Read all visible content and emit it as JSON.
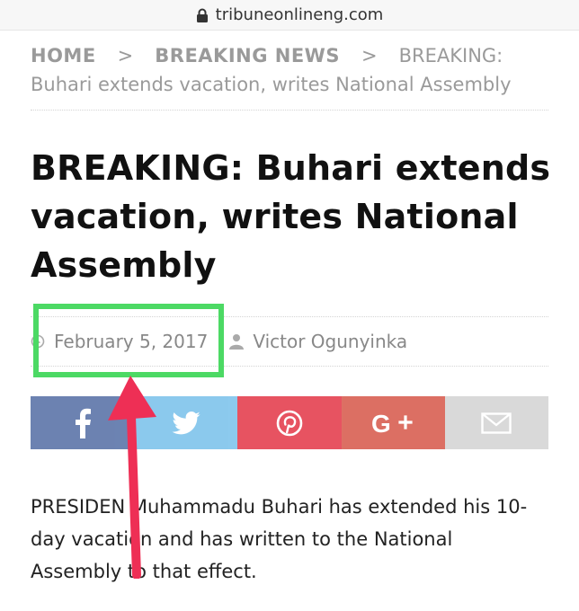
{
  "browser": {
    "url": "tribuneonlineng.com"
  },
  "breadcrumb": {
    "home": "HOME",
    "separator": ">",
    "section": "BREAKING NEWS",
    "current": "BREAKING: Buhari extends vacation, writes National Assembly"
  },
  "article": {
    "title": "BREAKING: Buhari extends vacation, writes National Assembly",
    "date": "February 5, 2017",
    "author": "Victor Ogunyinka",
    "paragraph_before_arrow": "PRESIDEN",
    "paragraph_after_arrow": " Muhammadu Buhari has extended his 10-day vac",
    "paragraph_rest": "ation and has written to the National Assembly to that effect."
  },
  "share_buttons": [
    {
      "network": "facebook",
      "icon": "facebook-icon",
      "color": "#3b5998"
    },
    {
      "network": "twitter",
      "icon": "twitter-icon",
      "color": "#65b8e8"
    },
    {
      "network": "pinterest",
      "icon": "pinterest-icon",
      "color": "#e2293a"
    },
    {
      "network": "google-plus",
      "icon": "google-plus-icon",
      "color": "#d44c3d"
    },
    {
      "network": "email",
      "icon": "mail-icon",
      "color": "#d9d9d9"
    }
  ],
  "annotation": {
    "highlight_color": "#4cd964",
    "arrow_color": "#ee2f55"
  }
}
